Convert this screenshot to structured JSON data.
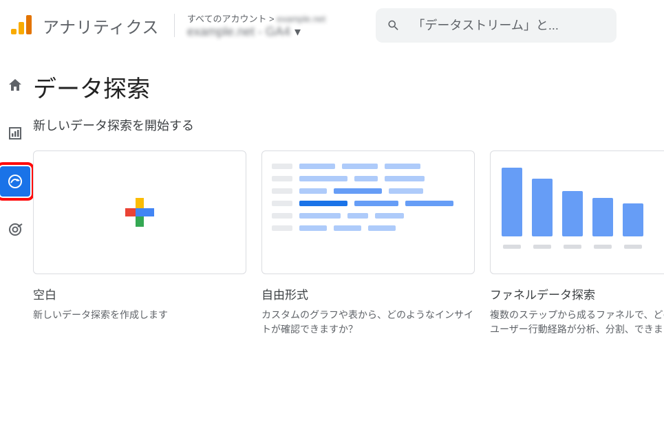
{
  "header": {
    "product": "アナリティクス",
    "account_line1_prefix": "すべてのアカウント > ",
    "account_line1_blur": "example.net",
    "account_line2_blur": "example.net - GA4",
    "search_placeholder": "「データストリーム」と..."
  },
  "nav": {
    "home": "ホーム",
    "reports": "レポート",
    "explore": "探索",
    "advertising": "広告"
  },
  "page": {
    "title": "データ探索",
    "subtitle": "新しいデータ探索を開始する"
  },
  "cards": [
    {
      "title": "空白",
      "desc": "新しいデータ探索を作成します"
    },
    {
      "title": "自由形式",
      "desc": "カスタムのグラフや表から、どのようなインサイトが確認できますか？"
    },
    {
      "title": "ファネルデータ探索",
      "desc": "複数のステップから成るファネルで、どのようなユーザー行動経路が分析、分割、できますか？"
    }
  ]
}
